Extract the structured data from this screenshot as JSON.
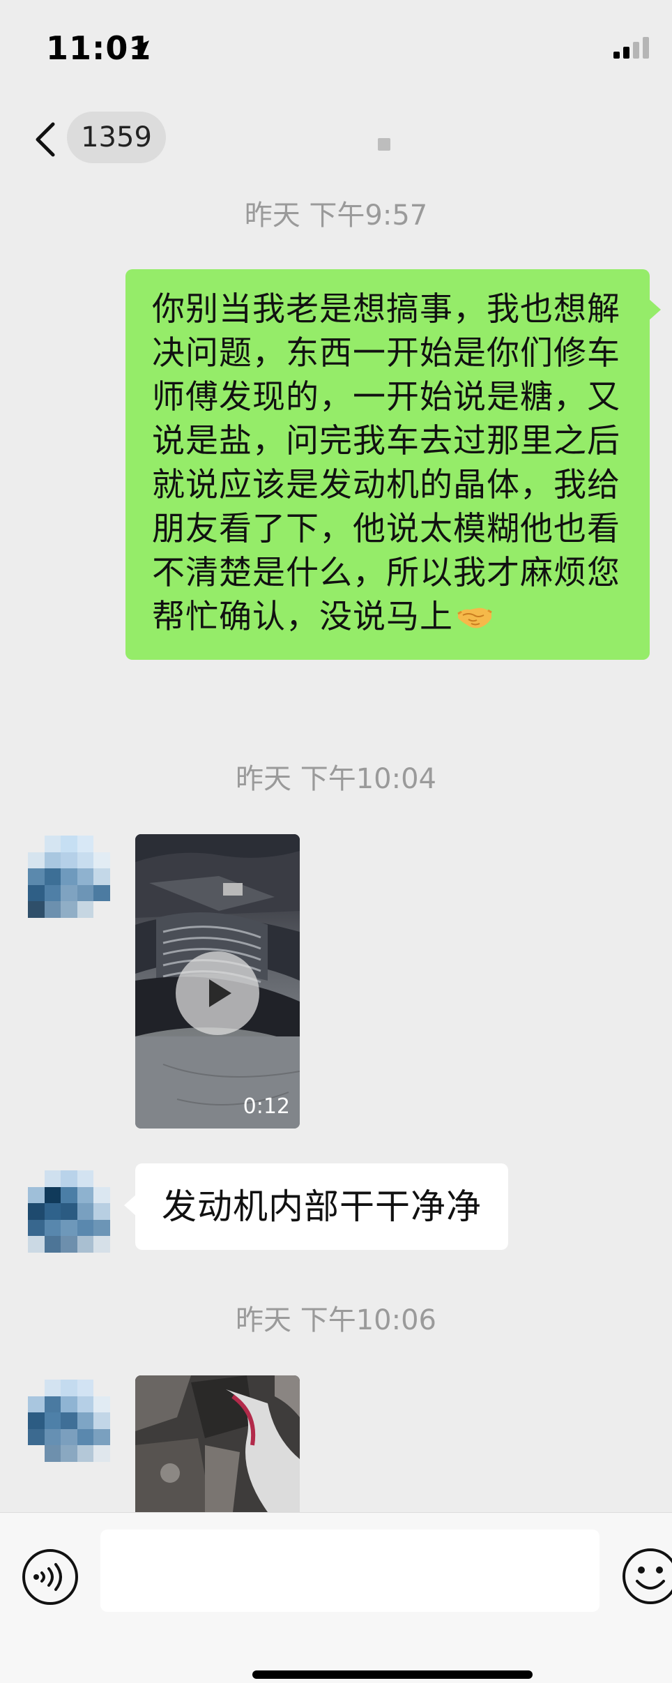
{
  "status_bar": {
    "time": "11:01",
    "location_icon": "location-arrow-icon",
    "signal_icon": "cellular-signal-icon"
  },
  "nav": {
    "back_icon": "chevron-left-icon",
    "unread_count": "1359"
  },
  "messages": {
    "timestamps": [
      "昨天 下午9:57",
      "昨天 下午10:04",
      "昨天 下午10:06"
    ],
    "sent_text": "你别当我老是想搞事，我也想解决问题，东西一开始是你们修车师傅发现的，一开始说是糖，又说是盐，问完我车去过那里之后就说应该是发动机的晶体，我给朋友看了下，他说太模糊他也看不清楚是什么，所以我才麻烦您帮忙确认，没说马上",
    "sent_emoji": "handshake-icon",
    "video_duration": "0:12",
    "received_text": "发动机内部干干净净"
  },
  "input_bar": {
    "voice_icon": "voice-input-icon",
    "emoji_icon": "emoji-smile-icon",
    "placeholder": ""
  },
  "colors": {
    "background": "#ededed",
    "sent_bubble": "#95ec69",
    "received_bubble": "#ffffff",
    "timestamp": "#9a9a9a"
  }
}
